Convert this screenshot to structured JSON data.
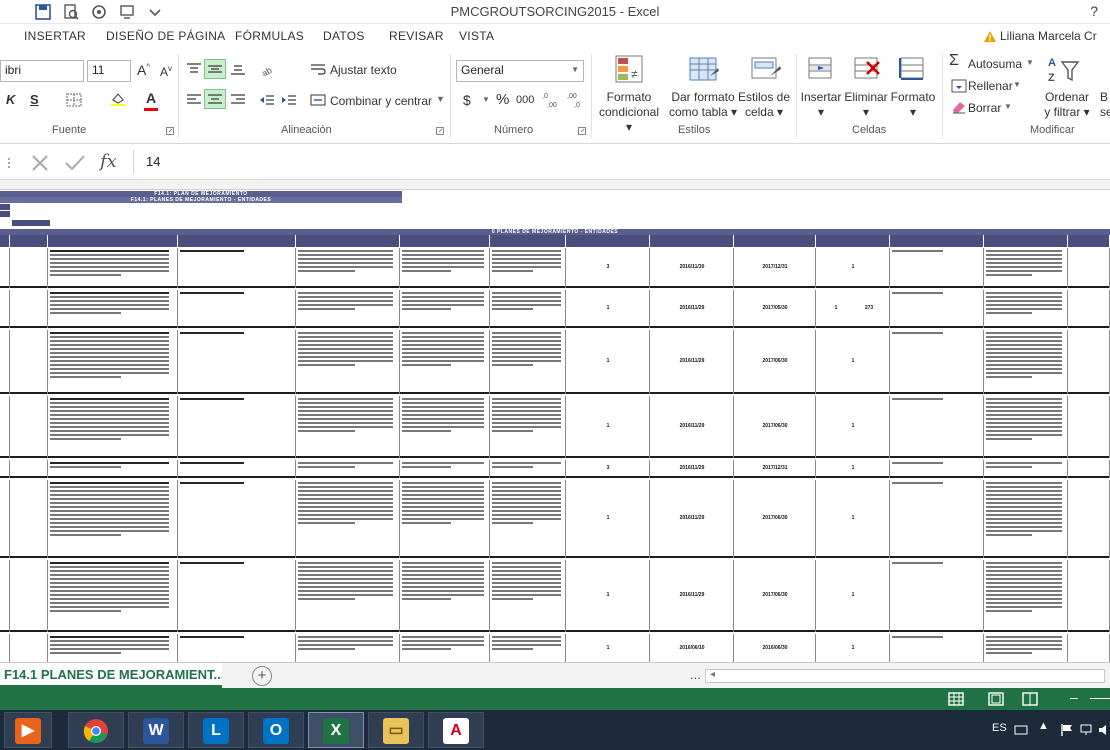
{
  "window": {
    "title": "PMCGROUTSORCING2015 - Excel",
    "help": "?"
  },
  "tabs": [
    "INSERTAR",
    "DISEÑO DE PÁGINA",
    "FÓRMULAS",
    "DATOS",
    "REVISAR",
    "VISTA"
  ],
  "user": "Liliana Marcela Cr",
  "ribbon": {
    "font_name": "ibri",
    "font_size": "11",
    "wrap_text": "Ajustar texto",
    "merge_center": "Combinar y centrar",
    "number_format": "General",
    "conditional_format_1": "Formato",
    "conditional_format_2": "condicional",
    "format_table_1": "Dar formato",
    "format_table_2": "como tabla",
    "cell_styles_1": "Estilos de",
    "cell_styles_2": "celda",
    "insert": "Insertar",
    "delete": "Eliminar",
    "format": "Formato",
    "autosum": "Autosuma",
    "fill": "Rellenar",
    "clear": "Borrar",
    "sort_filter_1": "Ordenar",
    "sort_filter_2": "y filtrar",
    "find_partial": "B",
    "find_partial_2": "sele",
    "groups": {
      "font": "Fuente",
      "alignment": "Alineación",
      "number": "Número",
      "styles": "Estilos",
      "cells": "Celdas",
      "editing": "Modificar"
    },
    "percent": "%",
    "thousands": "000",
    "currency": "$"
  },
  "formula_bar": {
    "fx": "fx",
    "value": "14"
  },
  "sheet": {
    "band_title_1": "F14.1: PLAN DE MEJORAMIENTO",
    "band_title_2": "F14.1: PLANES DE MEJORAMIENTO - ENTIDADES",
    "band_title_3": "0 PLANES DE MEJORAMIENTO - ENTIDADES",
    "rows": [
      {
        "c1": "3",
        "c2": "2016/11/30",
        "c3": "2017/12/31",
        "c4": "1"
      },
      {
        "c1": "1",
        "c2": "2016/11/29",
        "c3": "2017/05/30",
        "c4": "1",
        "c5": "273"
      },
      {
        "c1": "1",
        "c2": "2016/11/29",
        "c3": "2017/06/30",
        "c4": "1"
      },
      {
        "c1": "1",
        "c2": "2016/11/29",
        "c3": "2017/06/30",
        "c4": "1"
      },
      {
        "c1": "3",
        "c2": "2016/11/29",
        "c3": "2017/12/31",
        "c4": "1"
      },
      {
        "c1": "1",
        "c2": "2016/11/29",
        "c3": "2017/06/30",
        "c4": "1"
      },
      {
        "c1": "1",
        "c2": "2016/11/29",
        "c3": "2017/06/30",
        "c4": "1"
      },
      {
        "c1": "1",
        "c2": "2016/06/10",
        "c3": "2016/06/30",
        "c4": "1"
      }
    ]
  },
  "sheet_tab": "F14.1  PLANES DE MEJORAMIENT...",
  "sheet_tab_add": "+",
  "sheet_tab_more": "...",
  "taskbar": {
    "lang": "ES"
  }
}
